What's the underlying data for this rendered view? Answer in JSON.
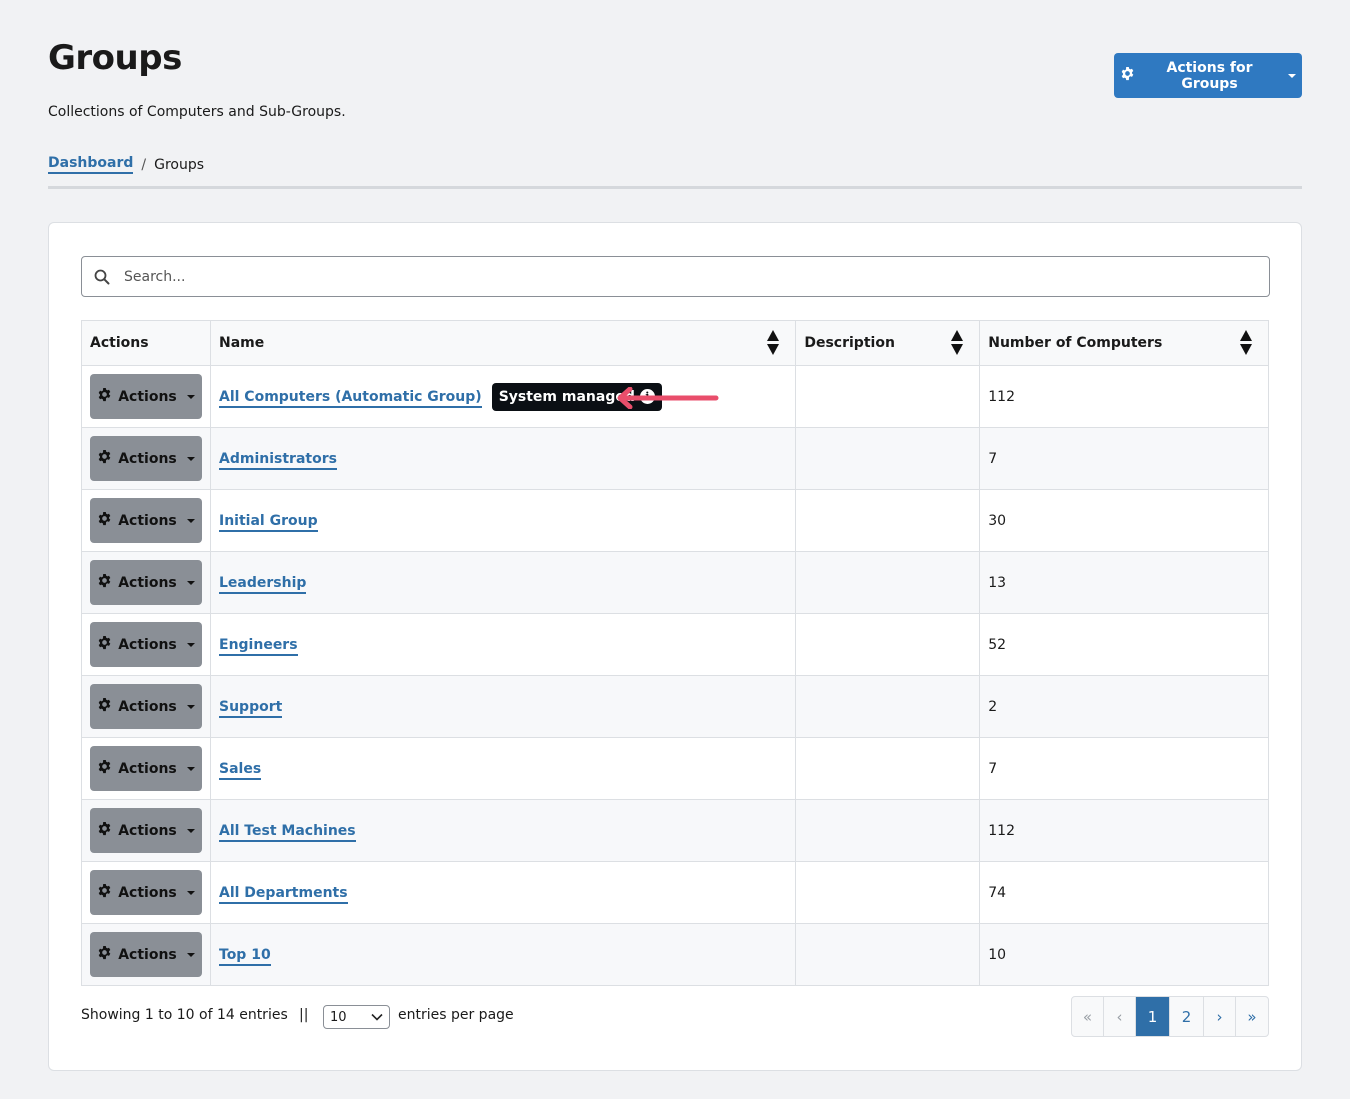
{
  "header": {
    "title": "Groups",
    "subtitle": "Collections of Computers and Sub-Groups.",
    "actions_button": "Actions for Groups"
  },
  "breadcrumb": {
    "link": "Dashboard",
    "separator": "/",
    "current": "Groups"
  },
  "search": {
    "placeholder": "Search..."
  },
  "table": {
    "columns": [
      "Actions",
      "Name",
      "Description",
      "Number of Computers"
    ],
    "row_action_label": "Actions",
    "badge_label": "System managed",
    "rows": [
      {
        "name": "All Computers (Automatic Group)",
        "description": "",
        "count": "112"
      },
      {
        "name": "Administrators",
        "description": "",
        "count": "7"
      },
      {
        "name": "Initial Group",
        "description": "",
        "count": "30"
      },
      {
        "name": "Leadership",
        "description": "",
        "count": "13"
      },
      {
        "name": "Engineers",
        "description": "",
        "count": "52"
      },
      {
        "name": "Support",
        "description": "",
        "count": "2"
      },
      {
        "name": "Sales",
        "description": "",
        "count": "7"
      },
      {
        "name": "All Test Machines",
        "description": "",
        "count": "112"
      },
      {
        "name": "All Departments",
        "description": "",
        "count": "74"
      },
      {
        "name": "Top 10",
        "description": "",
        "count": "10"
      }
    ]
  },
  "footer": {
    "showing": "Showing 1 to 10 of 14 entries",
    "separator": "||",
    "per_page_value": "10",
    "per_page_label": "entries per page"
  },
  "pagination": {
    "first": "«",
    "prev": "‹",
    "pages": [
      "1",
      "2"
    ],
    "next": "›",
    "last": "»",
    "current": "1"
  },
  "colors": {
    "primary": "#2f79c1",
    "link": "#2f6fa8",
    "action_button": "#8a8f96",
    "badge": "#0b0f14",
    "annotation_arrow": "#e94e6b"
  },
  "icons": {
    "primary_button": "gear-icon",
    "row_button": "gear-icon",
    "search": "search-icon",
    "badge": "info-icon"
  }
}
